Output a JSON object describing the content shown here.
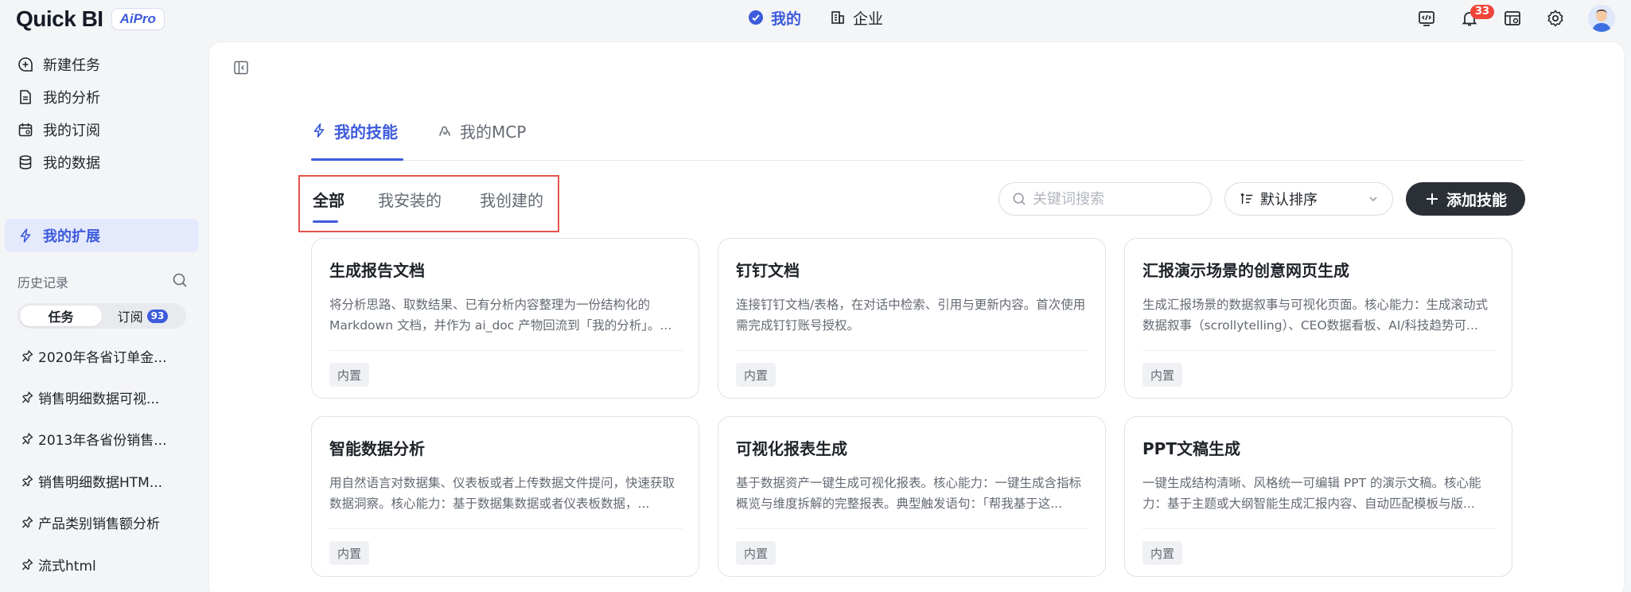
{
  "header": {
    "logo_text": "Quick BI",
    "logo_badge": "AiPro",
    "nav": [
      {
        "label": "我的",
        "icon": "circle-check-icon",
        "active": true
      },
      {
        "label": "企业",
        "icon": "building-icon",
        "active": false
      }
    ],
    "notifications_count": "33",
    "accent_color": "#3d5bdc"
  },
  "sidebar": {
    "items": [
      {
        "label": "新建任务",
        "icon": "plus-chat-icon"
      },
      {
        "label": "我的分析",
        "icon": "document-icon"
      },
      {
        "label": "我的订阅",
        "icon": "calendar-icon"
      },
      {
        "label": "我的数据",
        "icon": "database-icon"
      },
      {
        "label": "我的扩展",
        "icon": "lightning-icon",
        "active": true
      }
    ],
    "history_title": "历史记录",
    "history_tabs": [
      {
        "label": "任务",
        "active": true
      },
      {
        "label": "订阅",
        "count": "93"
      }
    ],
    "history_items": [
      "2020年各省订单金...",
      "销售明细数据可视...",
      "2013年各省份销售...",
      "销售明细数据HTM...",
      "产品类别销售额分析",
      "流式html"
    ]
  },
  "main": {
    "tabs": [
      {
        "label": "我的技能",
        "icon": "lightning-icon",
        "active": true
      },
      {
        "label": "我的MCP",
        "icon": "plug-icon",
        "active": false
      }
    ],
    "filters": [
      {
        "label": "全部",
        "active": true
      },
      {
        "label": "我安装的"
      },
      {
        "label": "我创建的"
      }
    ],
    "search": {
      "placeholder": "关键词搜索",
      "value": ""
    },
    "sort": {
      "label": "默认排序"
    },
    "add_button": "添加技能",
    "cards": [
      {
        "title": "生成报告文档",
        "desc": "将分析思路、取数结果、已有分析内容整理为一份结构化的 Markdown 文档，并作为 ai_doc 产物回流到「我的分析」。...",
        "tag": "内置"
      },
      {
        "title": "钉钉文档",
        "desc": "连接钉钉文档/表格，在对话中检索、引用与更新内容。首次使用需完成钉钉账号授权。",
        "tag": "内置"
      },
      {
        "title": "汇报演示场景的创意网页生成",
        "desc": "生成汇报场景的数据叙事与可视化页面。核心能力：生成滚动式数据叙事（scrollytelling）、CEO数据看板、AI/科技趋势可...",
        "tag": "内置"
      },
      {
        "title": "智能数据分析",
        "desc": "用自然语言对数据集、仪表板或者上传数据文件提问，快速获取数据洞察。核心能力：基于数据集数据或者仪表板数据，...",
        "tag": "内置"
      },
      {
        "title": "可视化报表生成",
        "desc": "基于数据资产一键生成可视化报表。核心能力：一键生成含指标概览与维度拆解的完整报表。典型触发语句：「帮我基于这...",
        "tag": "内置"
      },
      {
        "title": "PPT文稿生成",
        "desc": "一键生成结构清晰、风格统一可编辑 PPT 的演示文稿。核心能力：基于主题或大纲智能生成汇报内容、自动匹配模板与版...",
        "tag": "内置"
      }
    ]
  }
}
